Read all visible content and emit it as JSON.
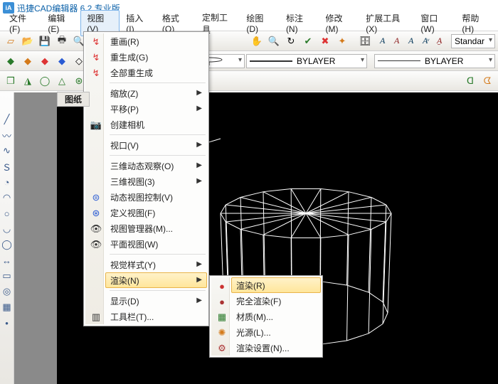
{
  "app": {
    "title": "迅捷CAD编辑器 6.2 专业版"
  },
  "menubar": {
    "file": "文件(F)",
    "edit": "编辑(E)",
    "view": "视图(V)",
    "insert": "插入(I)",
    "format": "格式(O)",
    "custom": "定制工具",
    "draw": "绘图(D)",
    "dim": "标注(N)",
    "modify": "修改(M)",
    "ext": "扩展工具(X)",
    "window": "窗口(W)",
    "help": "帮助(H)"
  },
  "toolbars": {
    "layer_label": "BYLAYER",
    "style_label": "Standar"
  },
  "doc": {
    "label": "图纸"
  },
  "viewmenu": {
    "redraw": "重画(R)",
    "regen": "重生成(G)",
    "regenall": "全部重生成",
    "zoom": "缩放(Z)",
    "pan": "平移(P)",
    "createcam": "创建相机",
    "viewport": "视口(V)",
    "orbit": "三维动态观察(O)",
    "view3": "三维视图(3)",
    "dynview": "动态视图控制(V)",
    "defview": "定义视图(F)",
    "viewmgr": "视图管理器(M)...",
    "planview": "平面视图(W)",
    "visstyle": "视觉样式(Y)",
    "render": "渲染(N)",
    "display": "显示(D)",
    "toolbar": "工具栏(T)..."
  },
  "rendersub": {
    "render": "渲染(R)",
    "fullrender": "完全渲染(F)",
    "material": "材质(M)...",
    "light": "光源(L)...",
    "settings": "渲染设置(N)..."
  }
}
